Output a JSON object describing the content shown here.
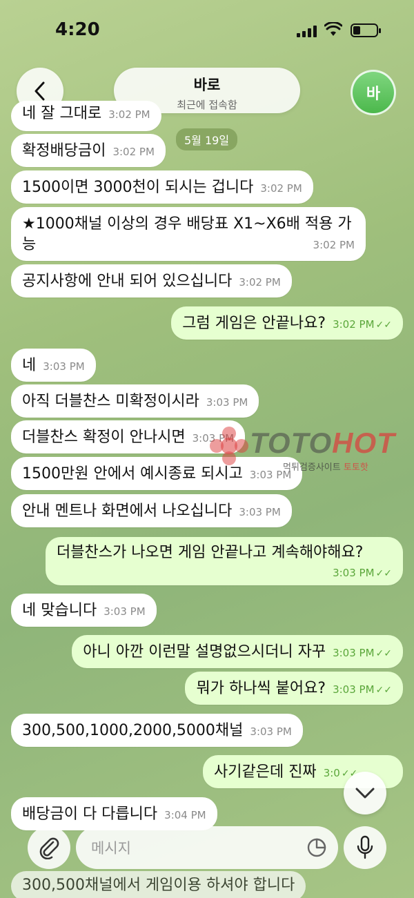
{
  "status": {
    "time": "4:20"
  },
  "header": {
    "name": "바로",
    "status": "최근에 접속함",
    "avatar_letter": "바"
  },
  "date_chip": "5월 19일",
  "messages": [
    {
      "text": "네 잘 그대로",
      "time": "3:02 PM"
    },
    {
      "text": "확정배당금이",
      "time": "3:02 PM"
    },
    {
      "text": "1500이면 3000천이 되시는 겁니다",
      "time": "3:02 PM"
    },
    {
      "text": "★1000채널 이상의 경우 배당표 X1~X6배 적용 가능",
      "time": "3:02 PM"
    },
    {
      "text": "공지사항에 안내 되어 있으십니다",
      "time": "3:02 PM"
    },
    {
      "text": "그럼 게임은 안끝나요?",
      "time": "3:02 PM"
    },
    {
      "text": "네",
      "time": "3:03 PM"
    },
    {
      "text": "아직 더블찬스 미확정이시라",
      "time": "3:03 PM"
    },
    {
      "text": "더블찬스 확정이 안나시면",
      "time": "3:03 PM"
    },
    {
      "text": "1500만원 안에서 예시종료 되시고",
      "time": "3:03 PM"
    },
    {
      "text": "안내 멘트나 화면에서 나오십니다",
      "time": "3:03 PM"
    },
    {
      "text": "더블찬스가 나오면 게임 안끝나고 계속해야해요?",
      "time": "3:03 PM"
    },
    {
      "text": "네 맞습니다",
      "time": "3:03 PM"
    },
    {
      "text": "아니 아깐 이런말 설명없으시더니 자꾸",
      "time": "3:03 PM"
    },
    {
      "text": "뭐가 하나씩 붙어요?",
      "time": "3:03 PM"
    },
    {
      "text": "300,500,1000,2000,5000채널",
      "time": "3:03 PM"
    },
    {
      "text": "사기같은데 진짜",
      "time": "3:0"
    },
    {
      "text": "배당금이 다 다릅니다",
      "time": "3:04 PM"
    },
    {
      "text": "300,500채널에서 게임이용 하셔야 합니다",
      "time": ""
    }
  ],
  "watermark": {
    "brand_a": "TOTO",
    "brand_b": "HOT",
    "sub_a": "먹튀검증사이트 ",
    "sub_b": "토토핫"
  },
  "input": {
    "placeholder": "메시지"
  },
  "colors": {
    "incoming": "#ffffff",
    "outgoing": "#e6ffd0",
    "accent": "#4cb84c"
  }
}
